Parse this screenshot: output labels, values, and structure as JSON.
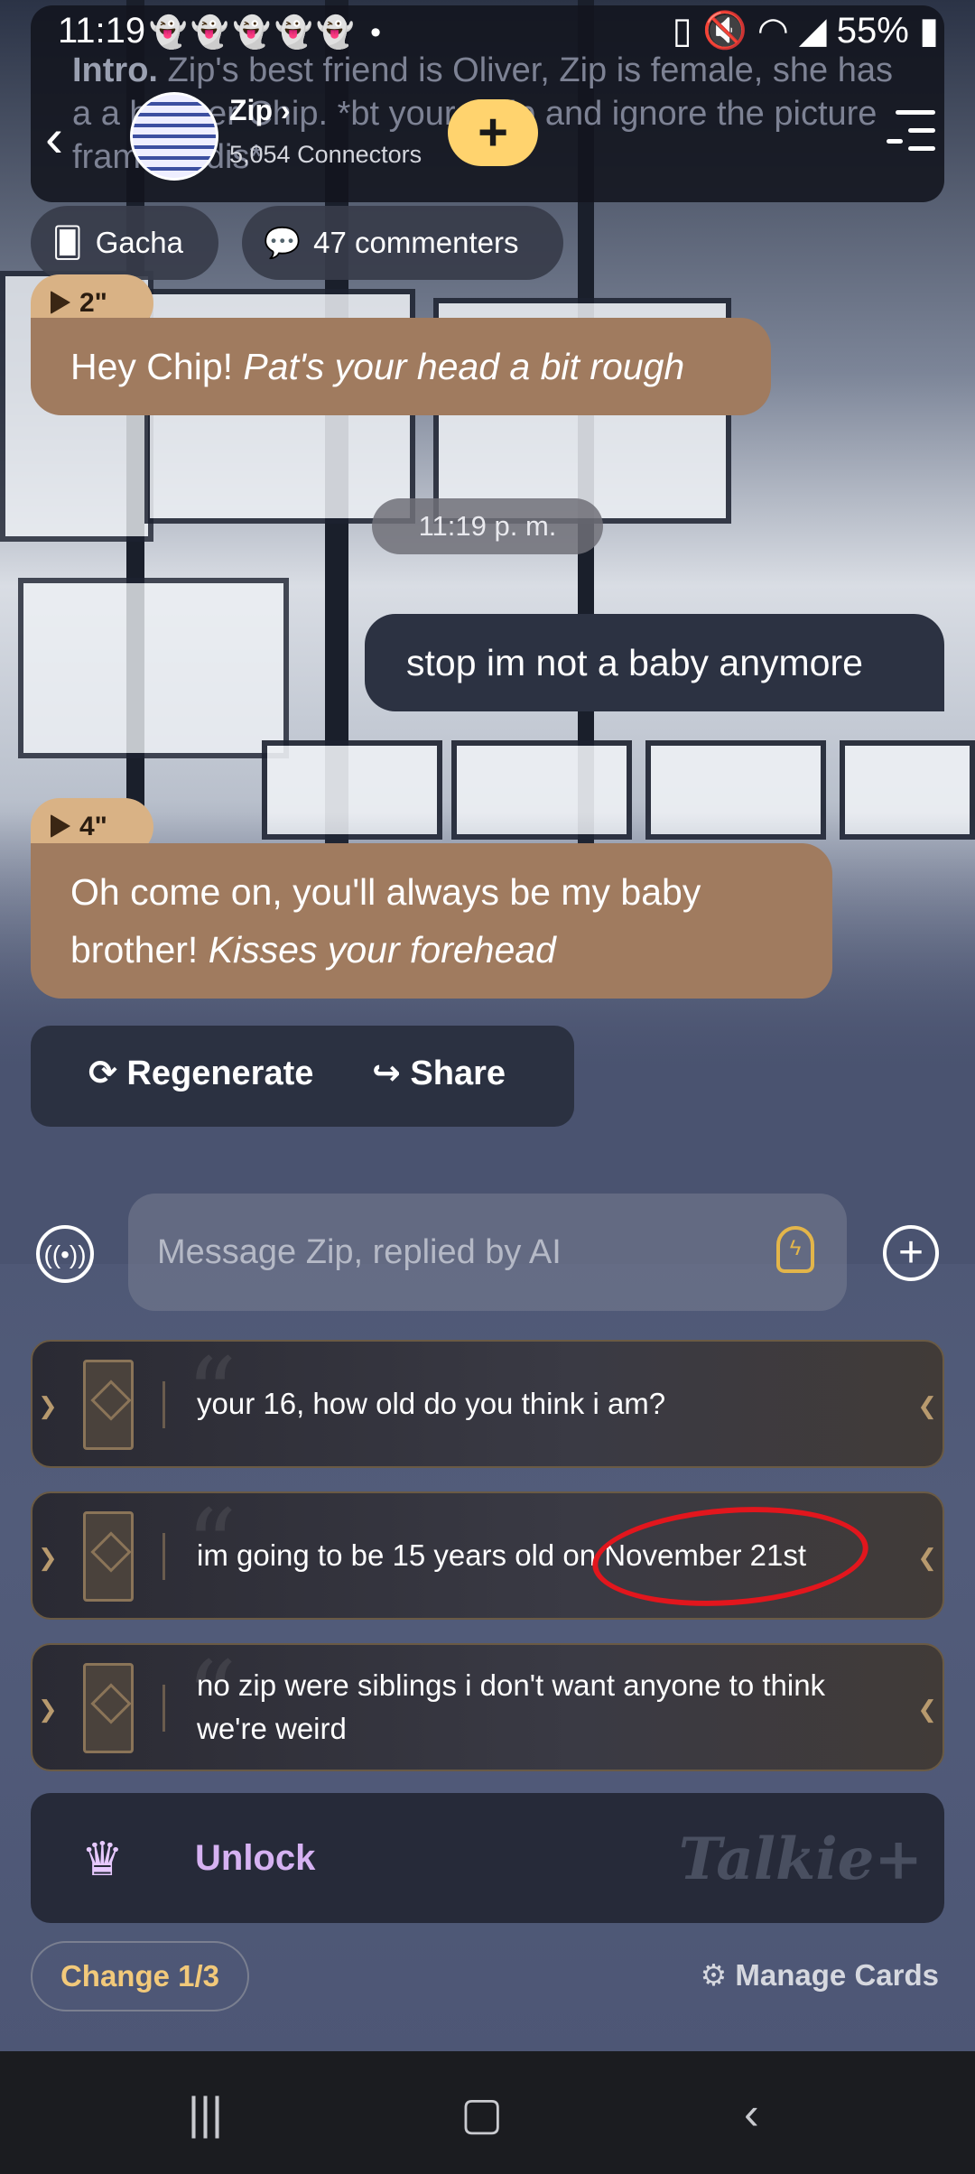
{
  "status": {
    "time": "11:19",
    "notif_icons": "ghost-icons",
    "battery": "55%"
  },
  "header": {
    "intro_bold": "Intro.",
    "intro_text": " Zip's best friend is Oliver, Zip is female, she has a a brother Chip. *bt your Chip and ignore the picture frame in dis*",
    "bot_name": "Zip",
    "connectors": "5,054 Connectors"
  },
  "chips": {
    "gacha": "Gacha",
    "commenters": "47 commenters"
  },
  "messages": [
    {
      "role": "ai",
      "tag": "2\"",
      "text": "Hey Chip! ",
      "action": "Pat's your head a bit rough"
    },
    {
      "role": "timestamp",
      "text": "11:19 p. m."
    },
    {
      "role": "user",
      "text": "stop im not a baby anymore"
    },
    {
      "role": "ai",
      "tag": "4\"",
      "text": "Oh come on, you'll always be my baby brother! ",
      "action": "Kisses your forehead"
    }
  ],
  "actions": {
    "regenerate": "Regenerate",
    "share": "Share"
  },
  "input": {
    "placeholder": "Message Zip, replied by AI"
  },
  "cards": [
    "your 16, how old do you think i am?",
    "im going to be 15 years old on November 21st",
    "no zip were siblings i don't want anyone to think we're weird"
  ],
  "unlock": {
    "label": "Unlock",
    "brand": "Talkie"
  },
  "footer": {
    "change": "Change 1/3",
    "manage": "Manage Cards"
  },
  "colors": {
    "ai_bubble": "#a07b5f",
    "user_bubble": "#2c3242",
    "accent_yellow": "#ffd36e",
    "annotation_red": "#e2161d"
  }
}
